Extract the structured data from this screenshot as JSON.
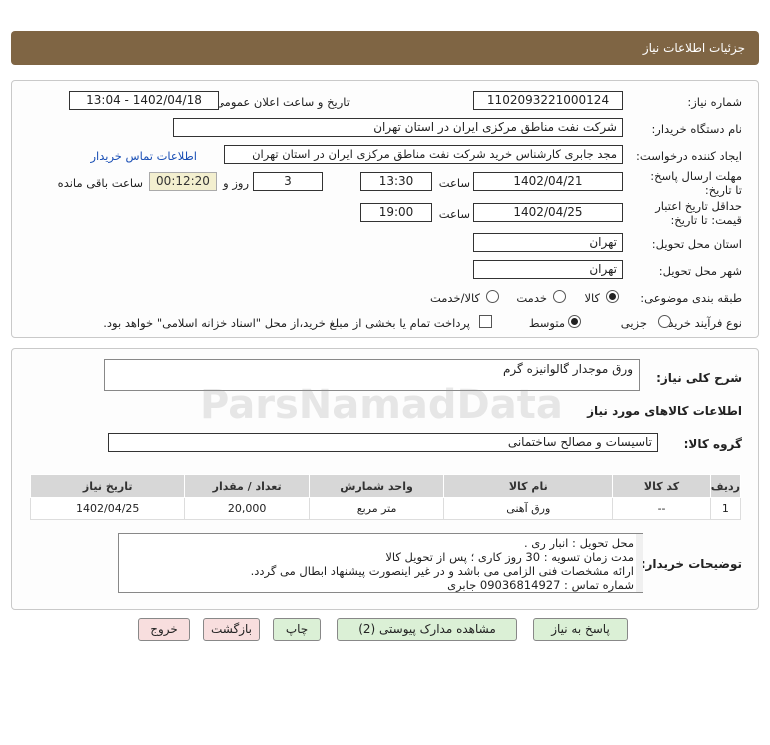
{
  "header": {
    "title": "جزئیات اطلاعات نیاز"
  },
  "form": {
    "need_number_label": "شماره نیاز:",
    "need_number": "1102093221000124",
    "announce_label": "تاریخ و ساعت اعلان عمومی:",
    "announce_value": "1402/04/18 - 13:04",
    "buyer_org_label": "نام دستگاه خریدار:",
    "buyer_org": "شرکت نفت مناطق مرکزی ایران در استان تهران",
    "creator_label": "ایجاد کننده درخواست:",
    "creator": "مجد جابری کارشناس خرید شرکت نفت مناطق مرکزی ایران در استان تهران",
    "contact_link": "اطلاعات تماس خریدار",
    "deadline_label": "مهلت ارسال پاسخ: تا تاریخ:",
    "deadline_date": "1402/04/21",
    "time_label": "ساعت",
    "deadline_time": "13:30",
    "days_value": "3",
    "days_label": "روز و",
    "remaining_time": "00:12:20",
    "remaining_label": "ساعت باقی مانده",
    "validity_label": "حداقل تاریخ اعتبار قیمت: تا تاریخ:",
    "validity_date": "1402/04/25",
    "validity_time": "19:00",
    "province_label": "استان محل تحویل:",
    "province": "تهران",
    "city_label": "شهر محل تحویل:",
    "city": "تهران",
    "category_label": "طبقه بندی موضوعی:",
    "category_options": [
      "کالا",
      "خدمت",
      "کالا/خدمت"
    ],
    "process_label": "نوع فرآیند خرید :",
    "process_options": [
      "جزیی",
      "متوسط"
    ],
    "payment_note": "پرداخت تمام یا بخشی از مبلغ خرید،از محل \"اسناد خزانه اسلامی\" خواهد بود."
  },
  "details": {
    "summary_label": "شرح کلی نیاز:",
    "summary": "ورق موجدار گالوانیزه گرم",
    "goods_info_title": "اطلاعات کالاهای مورد نیاز",
    "goods_group_label": "گروه کالا:",
    "goods_group": "تاسیسات و مصالح ساختمانی",
    "table": {
      "headers": [
        "ردیف",
        "کد کالا",
        "نام کالا",
        "واحد شمارش",
        "تعداد / مقدار",
        "تاریخ نیاز"
      ],
      "rows": [
        [
          "1",
          "--",
          "ورق آهنی",
          "متر مربع",
          "20,000",
          "1402/04/25"
        ]
      ]
    },
    "buyer_notes_label": "توضیحات خریدار:",
    "buyer_notes": [
      "محل تحویل : انبار ری .",
      "مدت زمان تسویه : 30 روز کاری ؛ پس از تحویل کالا",
      "ارائه مشخصات فنی الزامی می باشد و در غیر اینصورت پیشنهاد ابطال می گردد.",
      "شماره تماس : 09036814927 جابری"
    ]
  },
  "buttons": {
    "reply": "پاسخ به نیاز",
    "attachments": "مشاهده مدارک پیوستی (2)",
    "print": "چاپ",
    "back": "بازگشت",
    "exit": "خروج"
  },
  "watermark": {
    "brand": "ParsNamadData"
  }
}
